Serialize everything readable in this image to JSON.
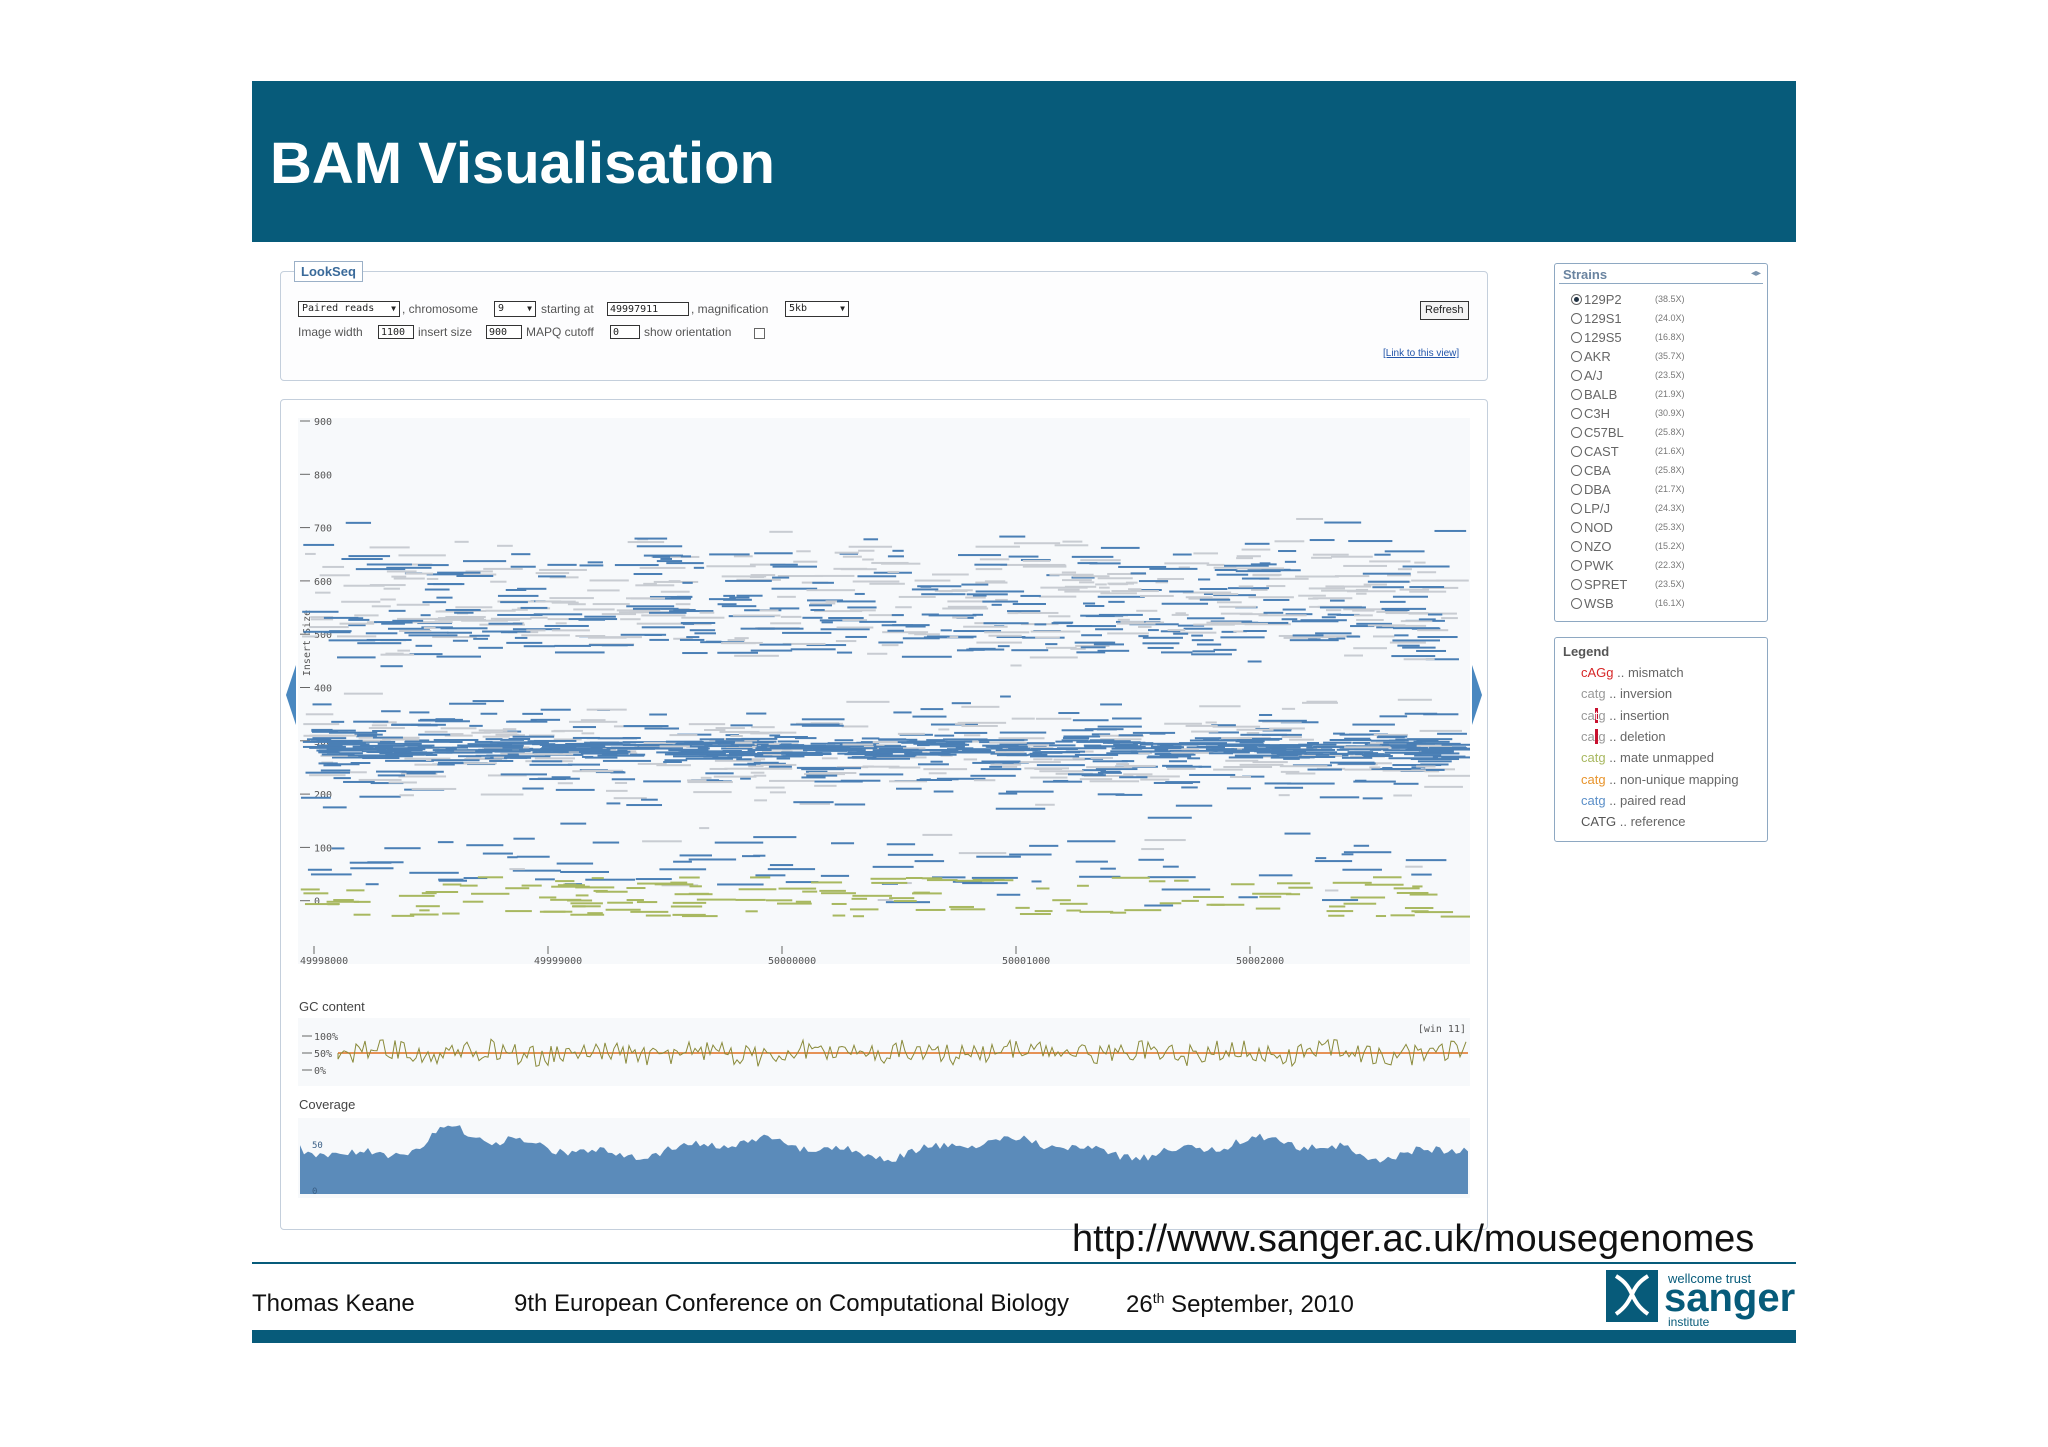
{
  "slide": {
    "title": "BAM Visualisation",
    "url": "http://www.sanger.ac.uk/mousegenomes",
    "footer": {
      "author": "Thomas Keane",
      "conference": "9th European Conference on Computational Biology",
      "date_day": "26",
      "date_sup": "th",
      "date_rest": " September, 2010"
    },
    "logo": {
      "top": "wellcome trust",
      "main": "sanger",
      "bottom": "institute"
    }
  },
  "lookseq": {
    "tab_label": "LookSeq",
    "mode": "Paired reads",
    "chromosome_label": ", chromosome",
    "chromosome": "9",
    "start_label": "starting at",
    "start": "49997911",
    "magnification_label": ", magnification",
    "magnification": "5kb",
    "image_width_label": "Image width",
    "image_width": "1100",
    "insert_size_label": "insert size",
    "insert_size": "900",
    "mapq_label": "MAPQ cutoff",
    "mapq": "0",
    "orientation_label": "show orientation",
    "refresh": "Refresh",
    "link": "[Link to this view]"
  },
  "plot": {
    "y_axis_label": "Insert Size",
    "y_ticks": [
      "900",
      "800",
      "700",
      "600",
      "500",
      "400",
      "300",
      "200",
      "100",
      "0"
    ],
    "x_ticks": [
      "49998000",
      "49999000",
      "50000000",
      "50001000",
      "50002000"
    ]
  },
  "gc": {
    "label": "GC content",
    "ticks": [
      "100%",
      "50%",
      "0%"
    ],
    "window": "[win 11]"
  },
  "coverage": {
    "label": "Coverage",
    "ticks": [
      "50",
      "0"
    ]
  },
  "strains": {
    "title": "Strains",
    "selected": "129P2",
    "items": [
      {
        "name": "129P2",
        "cov": "(38.5X)"
      },
      {
        "name": "129S1",
        "cov": "(24.0X)"
      },
      {
        "name": "129S5",
        "cov": "(16.8X)"
      },
      {
        "name": "AKR",
        "cov": "(35.7X)"
      },
      {
        "name": "A/J",
        "cov": "(23.5X)"
      },
      {
        "name": "BALB",
        "cov": "(21.9X)"
      },
      {
        "name": "C3H",
        "cov": "(30.9X)"
      },
      {
        "name": "C57BL",
        "cov": "(25.8X)"
      },
      {
        "name": "CAST",
        "cov": "(21.6X)"
      },
      {
        "name": "CBA",
        "cov": "(25.8X)"
      },
      {
        "name": "DBA",
        "cov": "(21.7X)"
      },
      {
        "name": "LP/J",
        "cov": "(24.3X)"
      },
      {
        "name": "NOD",
        "cov": "(25.3X)"
      },
      {
        "name": "NZO",
        "cov": "(15.2X)"
      },
      {
        "name": "PWK",
        "cov": "(22.3X)"
      },
      {
        "name": "SPRET",
        "cov": "(23.5X)"
      },
      {
        "name": "WSB",
        "cov": "(16.1X)"
      }
    ]
  },
  "legend": {
    "title": "Legend",
    "items": [
      {
        "sample": "cAGg",
        "desc": ".. mismatch",
        "color": "#d62728"
      },
      {
        "sample": "catg",
        "desc": ".. inversion",
        "color": "#999999"
      },
      {
        "sample": "catg",
        "desc": ".. insertion",
        "color": "#999999",
        "mark": "insert"
      },
      {
        "sample": "catg",
        "desc": ".. deletion",
        "color": "#999999",
        "mark": "delete"
      },
      {
        "sample": "catg",
        "desc": ".. mate unmapped",
        "color": "#a8b860"
      },
      {
        "sample": "catg",
        "desc": ".. non-unique mapping",
        "color": "#e8942c"
      },
      {
        "sample": "catg",
        "desc": ".. paired read",
        "color": "#5b8fc8"
      },
      {
        "sample": "CATG",
        "desc": ".. reference",
        "color": "#555555"
      }
    ]
  },
  "colors": {
    "header": "#075b7a",
    "read_blue": "#4a7fb5",
    "read_grey": "#c8ccd2",
    "read_olive": "#a8b860",
    "coverage": "#5b8bba",
    "gc_line": "#8a8a3a",
    "gc_mid": "#e07020"
  }
}
